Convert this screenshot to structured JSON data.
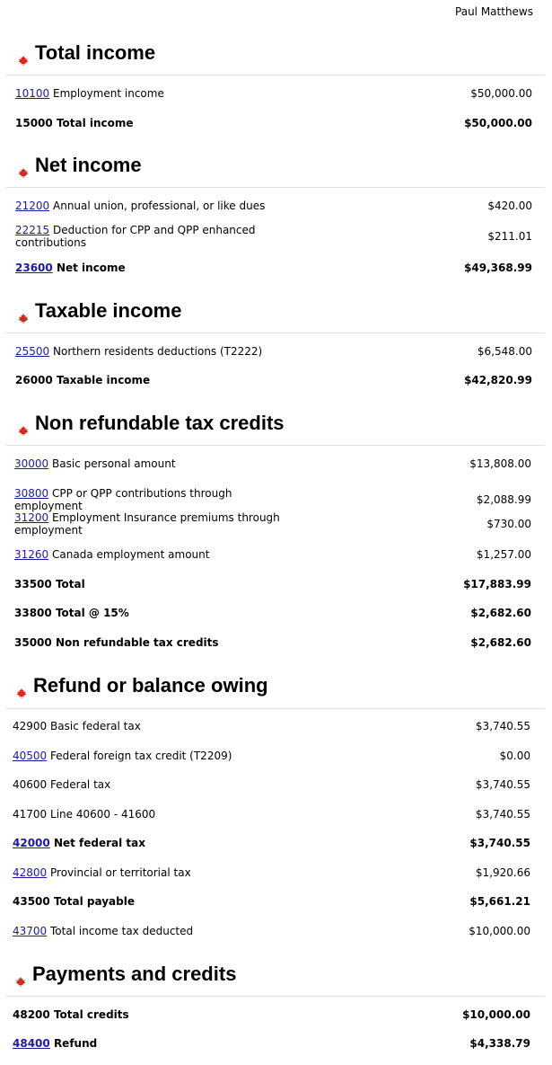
{
  "header": {
    "user": "Paul Matthews"
  },
  "sections": [
    {
      "title": "Total income",
      "rows": [
        {
          "code": "10100",
          "linked": true,
          "label": "Employment income",
          "amount": "$50,000.00",
          "bold": false
        },
        {
          "code": "15000",
          "linked": false,
          "label": "Total income",
          "amount": "$50,000.00",
          "bold": true
        }
      ]
    },
    {
      "title": "Net income",
      "rows": [
        {
          "code": "21200",
          "linked": true,
          "label": "Annual union, professional, or like dues",
          "amount": "$420.00",
          "bold": false
        },
        {
          "code": "22215",
          "linked": true,
          "label": "Deduction for CPP and QPP enhanced contributions",
          "amount": "$211.01",
          "bold": false
        },
        {
          "code": "23600",
          "linked": true,
          "label": "Net income",
          "amount": "$49,368.99",
          "bold": true
        }
      ]
    },
    {
      "title": "Taxable income",
      "rows": [
        {
          "code": "25500",
          "linked": true,
          "label": "Northern residents deductions (T2222)",
          "amount": "$6,548.00",
          "bold": false
        },
        {
          "code": "26000",
          "linked": false,
          "label": "Taxable income",
          "amount": "$42,820.99",
          "bold": true
        }
      ]
    },
    {
      "title": "Non refundable tax credits",
      "rows": [
        {
          "code": "30000",
          "linked": true,
          "label": "Basic personal amount",
          "amount": "$13,808.00",
          "bold": false
        },
        {
          "code": "30800",
          "linked": true,
          "label": "CPP or QPP contributions through employment",
          "amount": "$2,088.99",
          "bold": false
        },
        {
          "code": "31200",
          "linked": true,
          "label": "Employment Insurance premiums through employment",
          "amount": "$730.00",
          "bold": false
        },
        {
          "code": "31260",
          "linked": true,
          "label": "Canada employment amount",
          "amount": "$1,257.00",
          "bold": false
        },
        {
          "code": "33500",
          "linked": false,
          "label": "Total",
          "amount": "$17,883.99",
          "bold": true
        },
        {
          "code": "33800",
          "linked": false,
          "label": "Total @ 15%",
          "amount": "$2,682.60",
          "bold": true
        },
        {
          "code": "35000",
          "linked": false,
          "label": "Non refundable tax credits",
          "amount": "$2,682.60",
          "bold": true
        }
      ]
    },
    {
      "title": "Refund or balance owing",
      "rows": [
        {
          "code": "42900",
          "linked": false,
          "label": "Basic federal tax",
          "amount": "$3,740.55",
          "bold": false
        },
        {
          "code": "40500",
          "linked": true,
          "label": "Federal foreign tax credit (T2209)",
          "amount": "$0.00",
          "bold": false
        },
        {
          "code": "40600",
          "linked": false,
          "label": "Federal tax",
          "amount": "$3,740.55",
          "bold": false
        },
        {
          "code": "41700",
          "linked": false,
          "label": "Line 40600 - 41600",
          "amount": "$3,740.55",
          "bold": false
        },
        {
          "code": "42000",
          "linked": true,
          "label": "Net federal tax",
          "amount": "$3,740.55",
          "bold": true
        },
        {
          "code": "42800",
          "linked": true,
          "label": "Provincial or territorial tax",
          "amount": "$1,920.66",
          "bold": false
        },
        {
          "code": "43500",
          "linked": false,
          "label": "Total payable",
          "amount": "$5,661.21",
          "bold": true
        },
        {
          "code": "43700",
          "linked": true,
          "label": "Total income tax deducted",
          "amount": "$10,000.00",
          "bold": false
        }
      ]
    },
    {
      "title": "Payments and credits",
      "rows": [
        {
          "code": "48200",
          "linked": false,
          "label": "Total credits",
          "amount": "$10,000.00",
          "bold": true
        },
        {
          "code": "48400",
          "linked": true,
          "label": "Refund",
          "amount": "$4,338.79",
          "bold": true
        }
      ]
    }
  ],
  "colors": {
    "leaf": "#d52b1e",
    "link": "#1a1aa6",
    "rule": "#e1e1e1"
  },
  "icons": {
    "section": "maple-leaf-icon"
  }
}
